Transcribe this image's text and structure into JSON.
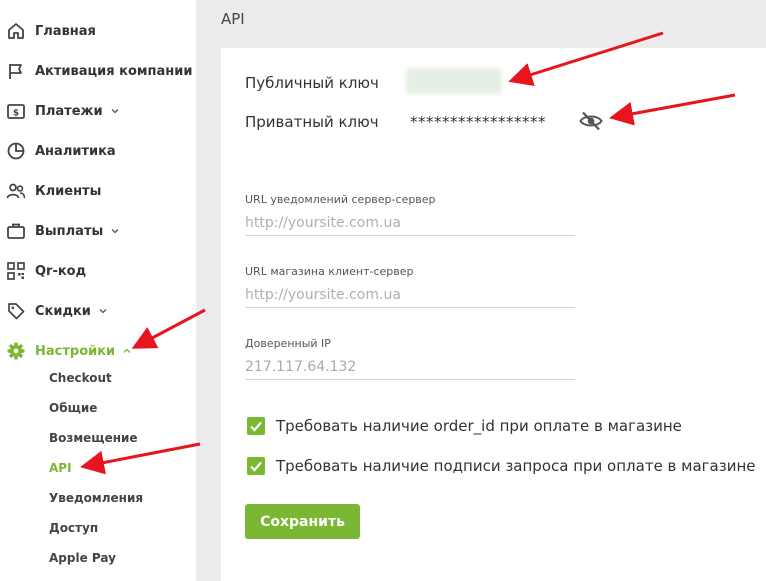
{
  "sidebar": {
    "items": [
      {
        "label": "Главная",
        "icon": "home-icon"
      },
      {
        "label": "Активация компании",
        "icon": "flag-icon"
      },
      {
        "label": "Платежи",
        "icon": "payments-icon"
      },
      {
        "label": "Аналитика",
        "icon": "pie-chart-icon"
      },
      {
        "label": "Клиенты",
        "icon": "users-icon"
      },
      {
        "label": "Выплаты",
        "icon": "wallet-icon"
      },
      {
        "label": "Qr-код",
        "icon": "qr-code-icon"
      },
      {
        "label": "Скидки",
        "icon": "tag-icon"
      },
      {
        "label": "Настройки",
        "icon": "gear-icon"
      }
    ],
    "submenu": [
      "Checkout",
      "Общие",
      "Возмещение",
      "API",
      "Уведомления",
      "Доступ",
      "Apple Pay"
    ]
  },
  "page": {
    "title": "API"
  },
  "keys": {
    "public_label": "Публичный ключ",
    "private_label": "Приватный ключ",
    "private_value": "*****************"
  },
  "fields": {
    "server_url_label": "URL уведомлений сервер-сервер",
    "server_url_placeholder": "http://yoursite.com.ua",
    "client_url_label": "URL магазина клиент-сервер",
    "client_url_placeholder": "http://yoursite.com.ua",
    "ip_label": "Доверенный IP",
    "ip_value": "217.117.64.132"
  },
  "checks": {
    "order_id": "Требовать наличие order_id при оплате в магазине",
    "signature": "Требовать наличие подписи запроса при оплате в магазине"
  },
  "buttons": {
    "save": "Сохранить"
  },
  "colors": {
    "accent": "#7ab733",
    "arrow": "#e8141e",
    "background": "#ececec"
  }
}
